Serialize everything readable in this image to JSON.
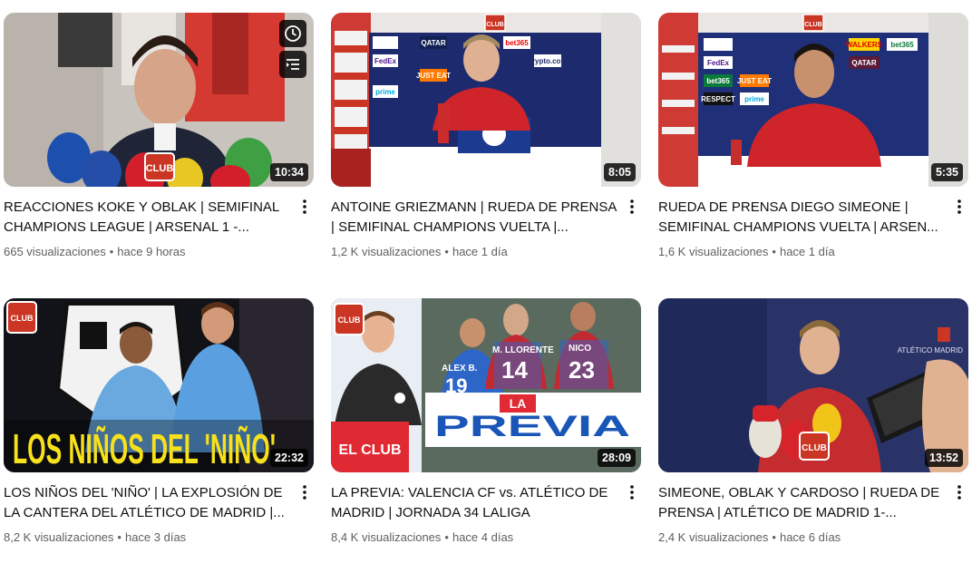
{
  "videos": [
    {
      "title": "REACCIONES KOKE Y OBLAK | SEMIFINAL CHAMPIONS LEAGUE | ARSENAL 1 -...",
      "duration": "10:34",
      "views": "665 visualizaciones",
      "age": "hace 9 horas",
      "thumb_text": "CLUB"
    },
    {
      "title": "ANTOINE GRIEZMANN | RUEDA DE PRENSA | SEMIFINAL CHAMPIONS VUELTA |...",
      "duration": "8:05",
      "views": "1,2 K visualizaciones",
      "age": "hace 1 día",
      "thumb_text": "CLUB"
    },
    {
      "title": "RUEDA DE PRENSA DIEGO SIMEONE | SEMIFINAL CHAMPIONS VUELTA | ARSEN...",
      "duration": "5:35",
      "views": "1,6 K visualizaciones",
      "age": "hace 1 día",
      "thumb_text": "CLUB"
    },
    {
      "title": "LOS NIÑOS DEL 'NIÑO' | LA EXPLOSIÓN DE LA CANTERA DEL ATLÉTICO DE MADRID |...",
      "duration": "22:32",
      "views": "8,2 K visualizaciones",
      "age": "hace 3 días",
      "thumb_text": "LOS NIÑOS DEL 'NIÑO'"
    },
    {
      "title": "LA PREVIA: VALENCIA CF vs. ATLÉTICO DE MADRID | JORNADA 34 LALIGA",
      "duration": "28:09",
      "views": "8,4 K visualizaciones",
      "age": "hace 4 días",
      "thumb_text": "PREVIA",
      "thumb_text_2": "LA",
      "thumb_text_3": "EL CLUB",
      "jersey_1": "M. LLORENTE",
      "jersey_2": "NICO",
      "jersey_3": "ALEX B.",
      "num_1": "14",
      "num_2": "23",
      "num_3": "19"
    },
    {
      "title": "SIMEONE, OBLAK Y CARDOSO | RUEDA DE PRENSA | ATLÉTICO DE MADRID 1-...",
      "duration": "13:52",
      "views": "2,4 K visualizaciones",
      "age": "hace 6 días",
      "thumb_text": "CLUB",
      "wall_text": "ATLÉTICO MADRID"
    }
  ],
  "sponsors": [
    "QATAR",
    "bet365",
    "FedEx",
    "ps5",
    "prime",
    "JUST EAT",
    "WALKERS",
    "crypto.com",
    "RESPECT"
  ],
  "separator": "•",
  "colors": {
    "title": "#0f0f0f",
    "meta": "#606060",
    "atleti_red": "#cb3524",
    "atleti_blue": "#262e61"
  }
}
